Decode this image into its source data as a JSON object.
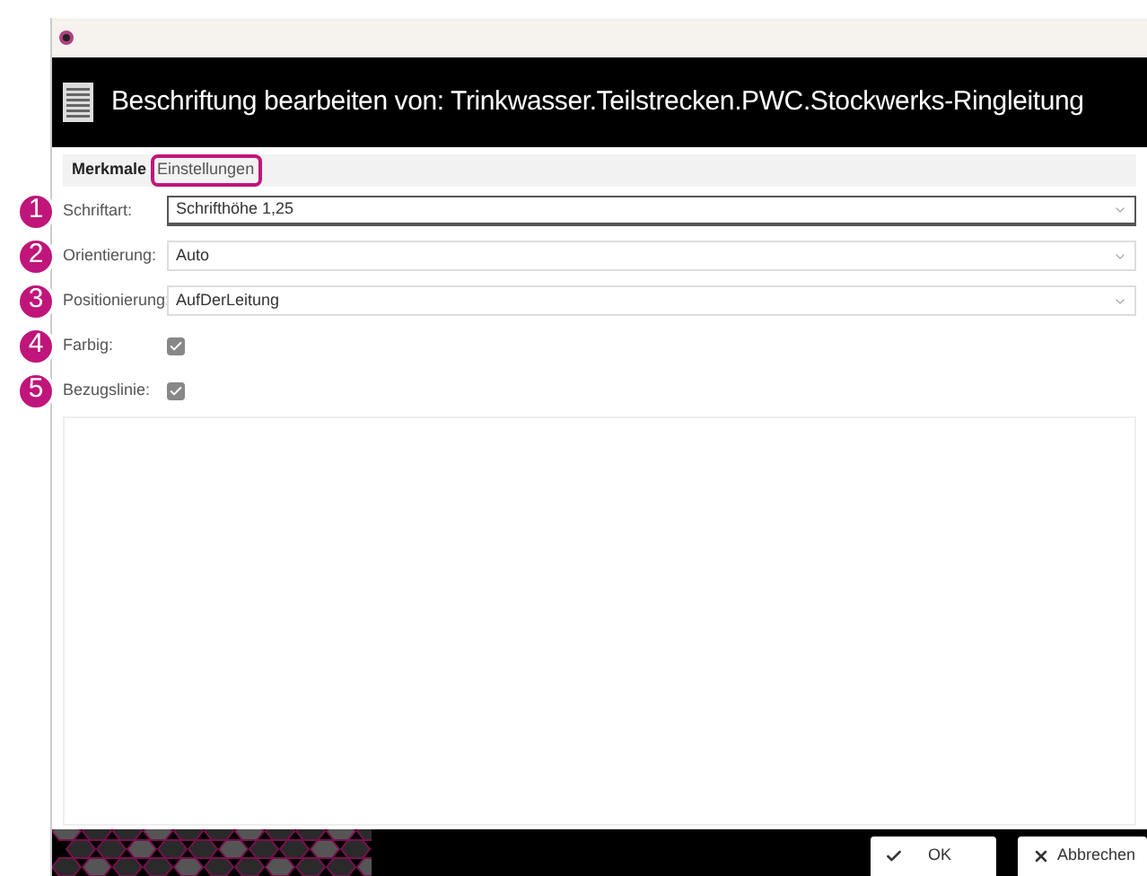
{
  "window": {
    "title": "Beschriftung bearbeiten von: Trinkwasser.Teilstrecken.PWC.Stockwerks-Ringleitung"
  },
  "tabs": [
    {
      "label": "Merkmale",
      "selected": true,
      "highlighted": false
    },
    {
      "label": "Einstellungen",
      "selected": false,
      "highlighted": true
    }
  ],
  "fields": [
    {
      "kind": "select",
      "marker": "1",
      "label": "Schriftart:",
      "value": "Schrifthöhe 1,25",
      "focused": true
    },
    {
      "kind": "select",
      "marker": "2",
      "label": "Orientierung:",
      "value": "Auto",
      "focused": false
    },
    {
      "kind": "select",
      "marker": "3",
      "label": "Positionierung:",
      "value": "AufDerLeitung",
      "focused": false
    },
    {
      "kind": "checkbox",
      "marker": "4",
      "label": "Farbig:",
      "checked": true
    },
    {
      "kind": "checkbox",
      "marker": "5",
      "label": "Bezugslinie:",
      "checked": true
    }
  ],
  "buttons": [
    {
      "kind": "ok",
      "label": "OK"
    },
    {
      "kind": "cancel",
      "label": "Abbrechen"
    }
  ]
}
